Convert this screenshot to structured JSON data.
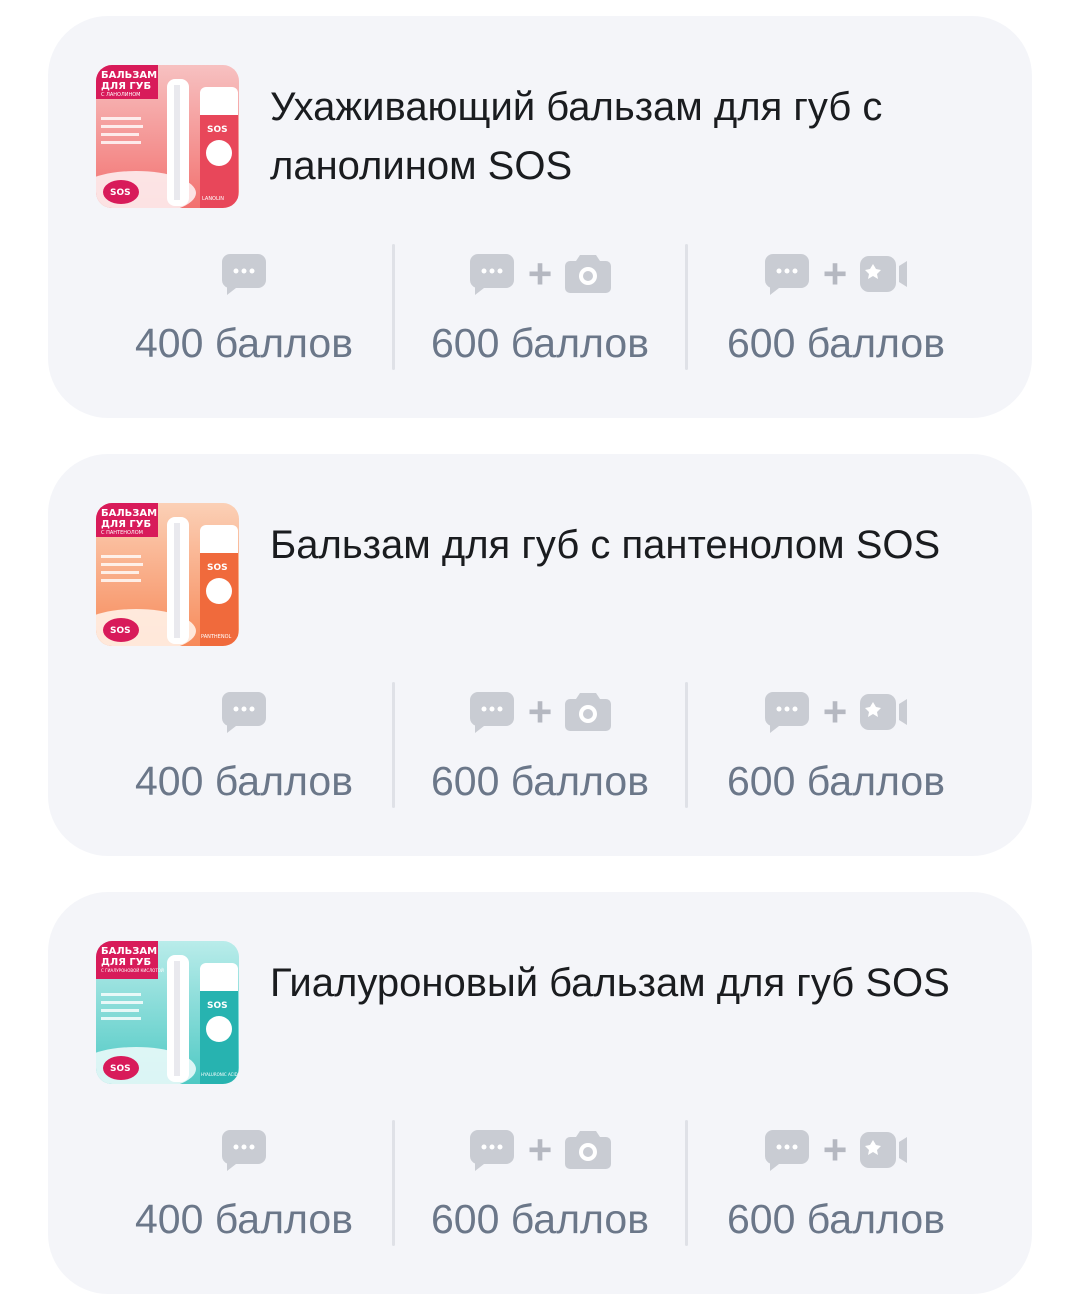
{
  "products": [
    {
      "title": "Ухаживающий бальзам для губ с ланолином SOS",
      "image_text": {
        "head": "БАЛЬЗАМ",
        "head2": "ДЛЯ ГУБ",
        "sub": "С ЛАНОЛИНОМ",
        "badge": "SOS",
        "ingredient": "LANOLIN"
      },
      "accent": "#e8475a",
      "bg_grad": [
        "#f7c1c1",
        "#f2716f"
      ],
      "rewards": [
        {
          "type": "review",
          "icons": [
            "chat-icon"
          ],
          "points": "400 баллов"
        },
        {
          "type": "review-photo",
          "icons": [
            "chat-icon",
            "camera-icon"
          ],
          "points": "600 баллов"
        },
        {
          "type": "review-video",
          "icons": [
            "chat-icon",
            "video-icon"
          ],
          "points": "600 баллов"
        }
      ]
    },
    {
      "title": "Бальзам для губ с пантенолом SOS",
      "image_text": {
        "head": "БАЛЬЗАМ",
        "head2": "ДЛЯ ГУБ",
        "sub": "С ПАНТЕНОЛОМ",
        "badge": "SOS",
        "ingredient": "PANTHENOL"
      },
      "accent": "#f06a3c",
      "bg_grad": [
        "#fbd0b6",
        "#f78a5a"
      ],
      "rewards": [
        {
          "type": "review",
          "icons": [
            "chat-icon"
          ],
          "points": "400 баллов"
        },
        {
          "type": "review-photo",
          "icons": [
            "chat-icon",
            "camera-icon"
          ],
          "points": "600 баллов"
        },
        {
          "type": "review-video",
          "icons": [
            "chat-icon",
            "video-icon"
          ],
          "points": "600 баллов"
        }
      ]
    },
    {
      "title": "Гиалуроновый бальзам для губ SOS",
      "image_text": {
        "head": "БАЛЬЗАМ",
        "head2": "ДЛЯ ГУБ",
        "sub": "С ГИАЛУРОНОВОЙ КИСЛОТОЙ",
        "badge": "SOS",
        "ingredient": "HYALURONIC ACID"
      },
      "accent": "#27b3b0",
      "bg_grad": [
        "#b9ecea",
        "#4fc9c4"
      ],
      "rewards": [
        {
          "type": "review",
          "icons": [
            "chat-icon"
          ],
          "points": "400 баллов"
        },
        {
          "type": "review-photo",
          "icons": [
            "chat-icon",
            "camera-icon"
          ],
          "points": "600 баллов"
        },
        {
          "type": "review-video",
          "icons": [
            "chat-icon",
            "video-icon"
          ],
          "points": "600 баллов"
        }
      ]
    }
  ],
  "colors": {
    "card_bg": "#f4f5f9",
    "icon": "#c9ccd3",
    "points_text": "#6b7789",
    "header_band": "#d81b5a"
  }
}
